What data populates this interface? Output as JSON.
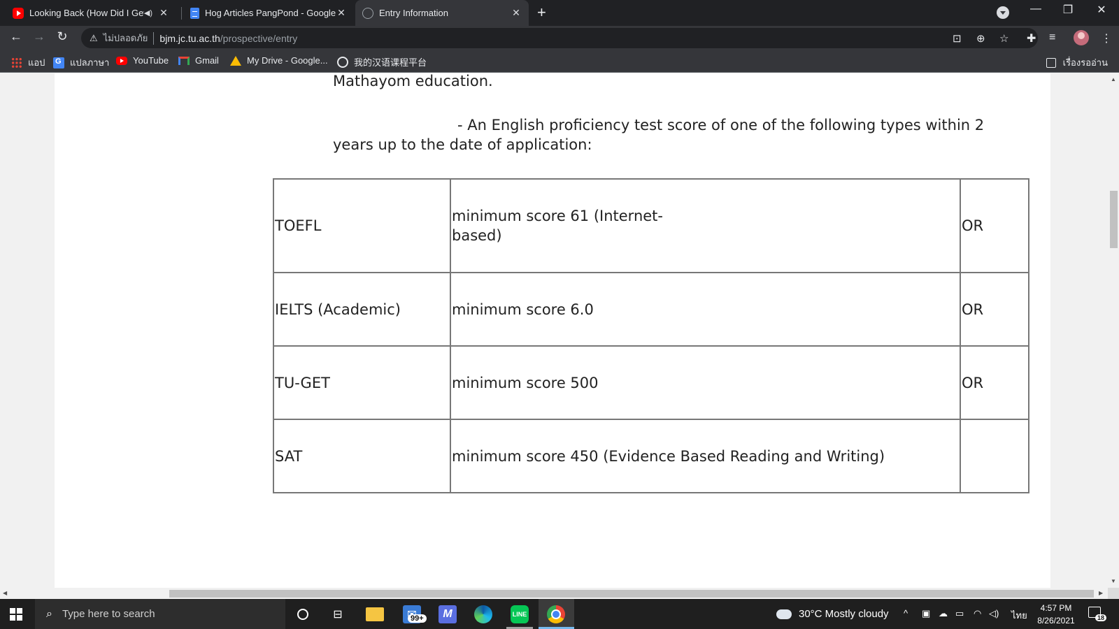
{
  "browser": {
    "tabs": [
      {
        "title": "Looking Back (How Did I Get",
        "favicon": "youtube-icon",
        "audio": true
      },
      {
        "title": "Hog Articles PangPond - Google",
        "favicon": "docs-icon",
        "audio": false
      },
      {
        "title": "Entry Information",
        "favicon": "globe-icon",
        "audio": false,
        "active": true
      }
    ],
    "omnibox": {
      "security_label": "ไม่ปลอดภัย",
      "url_host": "bjm.jc.tu.ac.th",
      "url_path": "/prospective/entry"
    },
    "bookmarks": [
      {
        "label": "แอป",
        "icon": "apps-grid-icon"
      },
      {
        "label": "แปลภาษา",
        "icon": "translate-icon"
      },
      {
        "label": "YouTube",
        "icon": "youtube-icon"
      },
      {
        "label": "Gmail",
        "icon": "gmail-icon"
      },
      {
        "label": "My Drive - Google...",
        "icon": "drive-icon"
      },
      {
        "label": "我的汉语课程平台",
        "icon": "globe-icon"
      }
    ],
    "reading_list": "เรื่องรออ่าน"
  },
  "content": {
    "para1": "Mathayom education.",
    "para2_line1": "- An English proficiency test score of one of the following types within 2",
    "para2_line2": "years up to the date of application:",
    "table": [
      {
        "test": "TOEFL",
        "requirement": "minimum score 61 (Internet-based)",
        "connector": "OR"
      },
      {
        "test": "IELTS (Academic)",
        "requirement": "minimum score 6.0",
        "connector": "OR"
      },
      {
        "test": "TU-GET",
        "requirement": "minimum score 500",
        "connector": "OR"
      },
      {
        "test": "SAT",
        "requirement": "minimum score 450 (Evidence Based Reading and Writing)",
        "connector": ""
      }
    ]
  },
  "taskbar": {
    "search_placeholder": "Type here to search",
    "mail_badge": "99+",
    "weather": "30°C  Mostly cloudy",
    "language": "ไทย",
    "time": "4:57 PM",
    "date": "8/26/2021",
    "notification_count": "18"
  }
}
